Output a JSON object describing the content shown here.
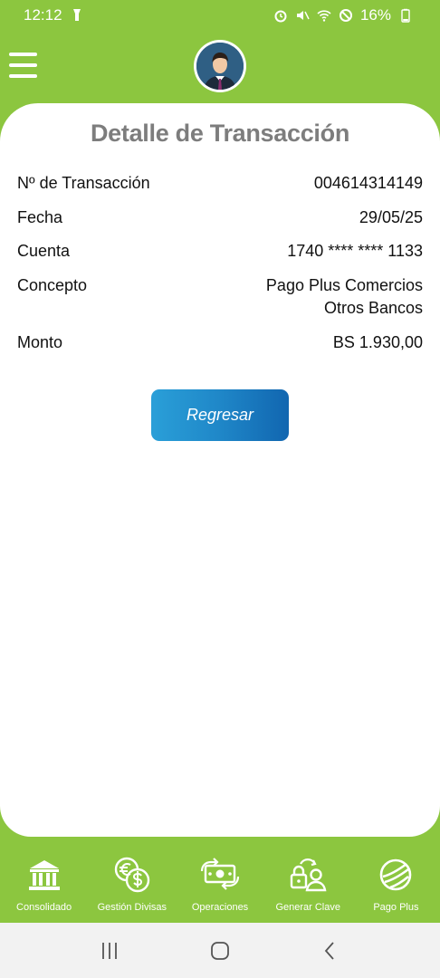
{
  "status_bar": {
    "time": "12:12",
    "battery": "16%",
    "icons": [
      "flashlight-icon",
      "alarm-icon",
      "mute-icon",
      "wifi-icon",
      "do-not-disturb-icon",
      "battery-icon"
    ]
  },
  "header": {
    "menu_icon": "hamburger-menu-icon",
    "avatar_icon": "user-avatar-icon"
  },
  "detail": {
    "title": "Detalle de Transacción",
    "rows": [
      {
        "label": "Nº de Transacción",
        "value": "004614314149"
      },
      {
        "label": "Fecha",
        "value": "29/05/25"
      },
      {
        "label": "Cuenta",
        "value": "1740 **** **** 1133"
      },
      {
        "label": "Concepto",
        "value_lines": [
          "Pago Plus Comercios",
          "Otros Bancos"
        ]
      },
      {
        "label": "Monto",
        "value": "BS 1.930,00"
      }
    ],
    "back_button_label": "Regresar"
  },
  "bottom_nav": {
    "items": [
      {
        "label": "Consolidado",
        "icon": "bank-icon"
      },
      {
        "label": "Gestión Divisas",
        "icon": "currency-exchange-icon"
      },
      {
        "label": "Operaciones",
        "icon": "money-transfer-icon"
      },
      {
        "label": "Generar Clave",
        "icon": "lock-user-icon"
      },
      {
        "label": "Pago Plus",
        "icon": "pago-plus-icon"
      }
    ]
  },
  "system_nav": {
    "icons": [
      "recent-apps-icon",
      "home-icon",
      "back-icon"
    ]
  },
  "colors": {
    "brand_green": "#8cc63f",
    "button_blue": "#1f87c8",
    "title_gray": "#7d7d7d"
  }
}
